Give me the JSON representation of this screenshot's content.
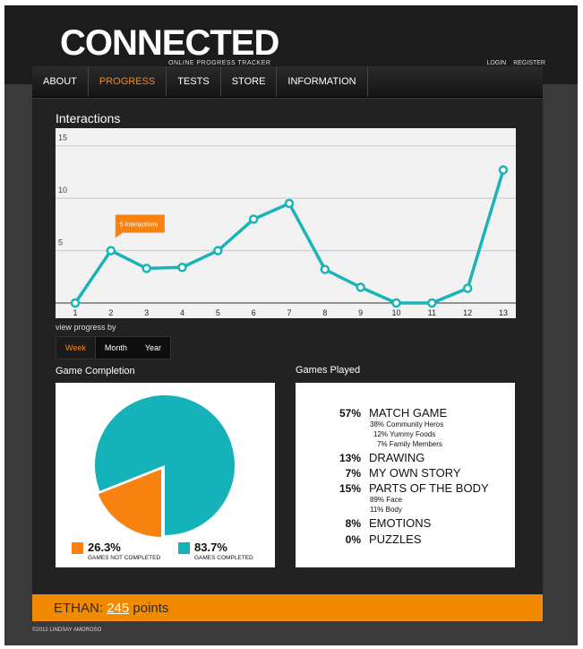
{
  "header": {
    "logo": "CONNECTED",
    "tagline": "ONLINE PROGRESS TRACKER",
    "links": [
      "LOGIN",
      "REGISTER"
    ]
  },
  "nav": {
    "items": [
      {
        "label": "ABOUT"
      },
      {
        "label": "PROGRESS"
      },
      {
        "label": "TESTS"
      },
      {
        "label": "STORE"
      },
      {
        "label": "INFORMATION"
      }
    ],
    "active": "PROGRESS"
  },
  "interactions": {
    "title": "Interactions",
    "tooltip": "5 Interactions",
    "view_label": "view progress by",
    "view_options": [
      "Week",
      "Month",
      "Year"
    ],
    "selected_view": "Week"
  },
  "chart_data": {
    "type": "line",
    "x": [
      1,
      2,
      3,
      4,
      5,
      6,
      7,
      8,
      9,
      10,
      11,
      12,
      13
    ],
    "values": [
      0,
      5,
      3.3,
      3.4,
      5,
      8,
      9.5,
      3.2,
      1.5,
      0,
      0,
      1.4,
      12.7
    ],
    "ylim": [
      0,
      16
    ],
    "yticks": [
      5,
      10,
      15
    ],
    "grid": true,
    "line_color": "#1ab3b8",
    "title": "",
    "xlabel": "",
    "ylabel": ""
  },
  "game_completion": {
    "title": "Game Completion",
    "not_completed": {
      "pct": "26.3%",
      "label": "GAMES NOT COMPLETED",
      "color": "#f7820f"
    },
    "completed": {
      "pct": "83.7%",
      "label": "GAMES COMPLETED",
      "color": "#15b2ba"
    },
    "pie_share_not_completed": 0.19
  },
  "games_played": {
    "title": "Games Played",
    "items": [
      {
        "pct": "57%",
        "name": "MATCH GAME",
        "subs": [
          "38%  Community Heros",
          "12%  Yummy Foods",
          "7%  Family Members"
        ]
      },
      {
        "pct": "13%",
        "name": "DRAWING",
        "subs": []
      },
      {
        "pct": "7%",
        "name": "MY OWN STORY",
        "subs": []
      },
      {
        "pct": "15%",
        "name": "PARTS OF THE BODY",
        "subs": [
          "89% Face",
          "11% Body"
        ]
      },
      {
        "pct": "8%",
        "name": "EMOTIONS",
        "subs": []
      },
      {
        "pct": "0%",
        "name": "PUZZLES",
        "subs": []
      }
    ]
  },
  "footer": {
    "name": "ETHAN:",
    "points": "245",
    "points_label": "points",
    "copyright": "©2012 LINDSAY AMOROSO"
  }
}
